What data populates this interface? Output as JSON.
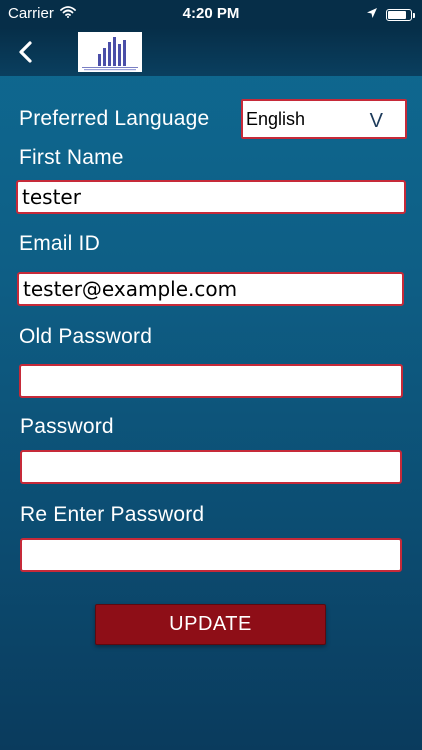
{
  "status_bar": {
    "carrier": "Carrier",
    "time": "4:20 PM",
    "battery_level": 0.9,
    "icons": [
      "wifi-icon",
      "location-arrow-icon",
      "battery-icon"
    ]
  },
  "nav": {
    "back_icon": "chevron-left-icon",
    "logo_icon": "building-logo-icon"
  },
  "form": {
    "preferred_language": {
      "label": "Preferred Language",
      "value": "English",
      "chevron": "V"
    },
    "first_name": {
      "label": "First Name",
      "value": "tester"
    },
    "email": {
      "label": "Email ID",
      "value": "tester@example.com"
    },
    "old_password": {
      "label": "Old Password",
      "value": ""
    },
    "password": {
      "label": "Password",
      "value": ""
    },
    "re_enter_password": {
      "label": "Re Enter Password",
      "value": ""
    },
    "update_label": "UPDATE"
  },
  "colors": {
    "background_top": "#0f6a92",
    "background_bottom": "#0a3b5d",
    "field_border": "#c62a39",
    "button_bg": "#8e0e17",
    "logo_blue": "#4a4ea8"
  }
}
